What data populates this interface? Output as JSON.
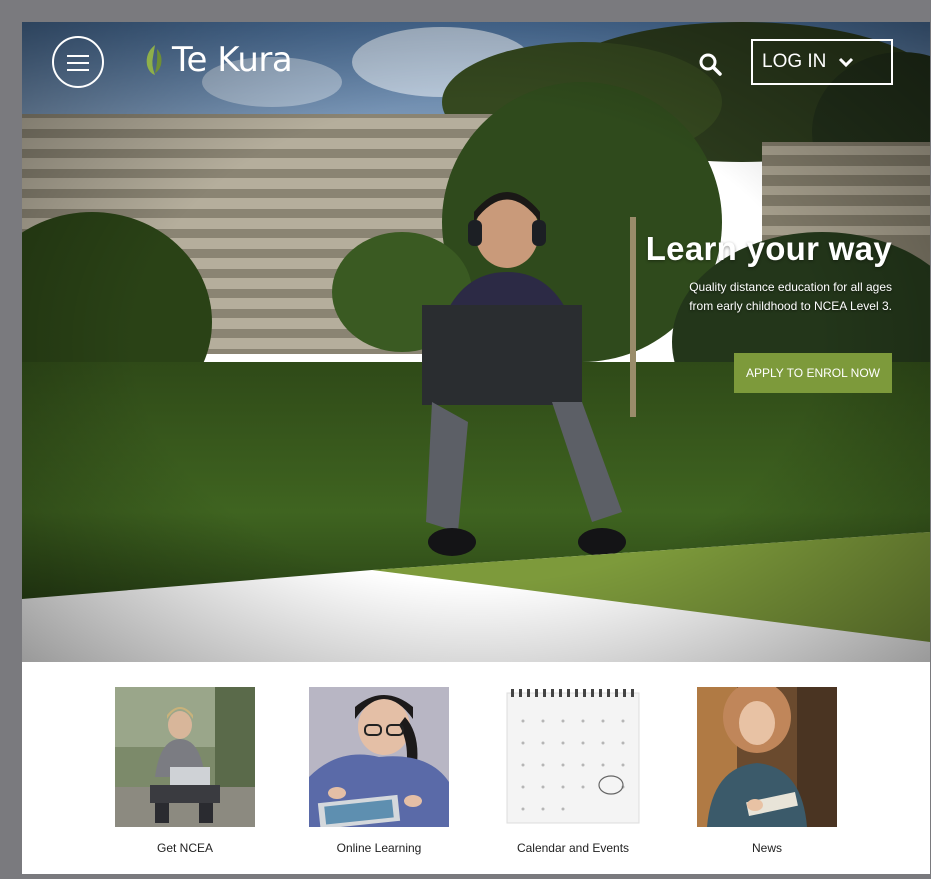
{
  "header": {
    "logo_text": "Te Kura",
    "login_label": "LOG IN"
  },
  "hero": {
    "title": "Learn your way",
    "subtitle_line1": "Quality distance education for all ages",
    "subtitle_line2": "from early childhood to NCEA Level 3.",
    "cta_label": "APPLY TO ENROL NOW"
  },
  "colors": {
    "accent_green": "#7d9a3b",
    "page_bg": "#ffffff",
    "outer_bg": "#7a7a7e"
  },
  "cards": [
    {
      "label": "Get NCEA",
      "icon": "student-with-laptop-photo"
    },
    {
      "label": "Online Learning",
      "icon": "student-with-tablet-photo"
    },
    {
      "label": "Calendar and Events",
      "icon": "calendar-photo"
    },
    {
      "label": "News",
      "icon": "student-reading-photo"
    }
  ]
}
